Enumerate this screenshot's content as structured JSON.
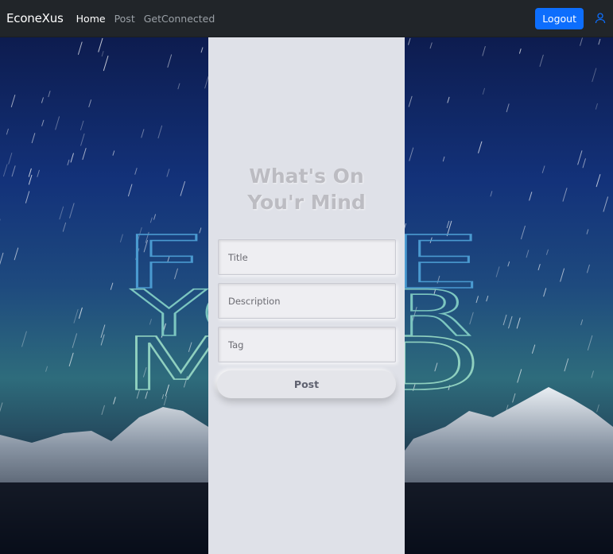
{
  "nav": {
    "brand": "EconeXus",
    "links": [
      {
        "label": "Home"
      },
      {
        "label": "Post"
      },
      {
        "label": "GetConnected"
      }
    ],
    "logout_label": "Logout",
    "user_icon": "user-icon"
  },
  "background": {
    "art_text": [
      "FREE",
      "YOUR",
      "MIND"
    ],
    "icon": "starry-mountain-background"
  },
  "form": {
    "heading_line1": "What's On",
    "heading_line2": "You'r Mind",
    "title_placeholder": "Title",
    "description_placeholder": "Description",
    "tag_placeholder": "Tag",
    "post_label": "Post"
  },
  "colors": {
    "navbar": "#212529",
    "accent": "#0d6efd",
    "panel": "#dfe1e8"
  }
}
